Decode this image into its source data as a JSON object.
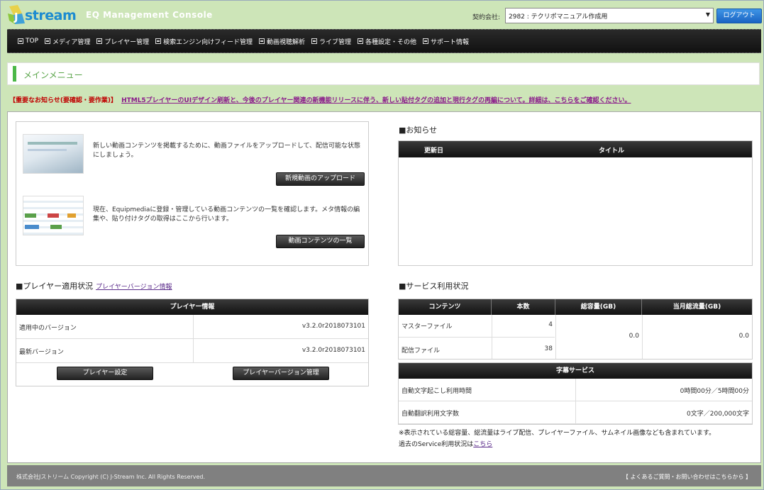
{
  "header": {
    "logo_text": "stream",
    "app_title": "EQ Management Console",
    "contract_label": "契約会社:",
    "contract_value": "2982 : テクリポマニュアル作成用",
    "logout_label": "ログアウト"
  },
  "nav": {
    "items": [
      "TOP",
      "メディア管理",
      "プレイヤー管理",
      "検索エンジン向けフィード管理",
      "動画視聴解析",
      "ライブ管理",
      "各種設定・その他",
      "サポート情報"
    ]
  },
  "page": {
    "title": "メインメニュー"
  },
  "notice": {
    "prefix": "【重要なお知らせ(要確認・要作業)】",
    "link_text": "HTML5プレイヤーのUIデザイン刷新と、今後のプレイヤー関連の新機能リリースに伴う、新しい貼付タグの追加と現行タグの再編について。詳細は、こちらをご確認ください。"
  },
  "promo": {
    "upload_text": "新しい動画コンテンツを掲載するために、動画ファイルをアップロードして、配信可能な状態にしましょう。",
    "upload_button": "新規動画のアップロード",
    "list_text": "現在、Equipmediaに登録・管理している動画コンテンツの一覧を確認します。メタ情報の編集や、貼り付けタグの取得はここから行います。",
    "list_button": "動画コンテンツの一覧"
  },
  "news": {
    "title": "■お知らせ",
    "col_date": "更新日",
    "col_title": "タイトル"
  },
  "player": {
    "section_title": "■プレイヤー適用状況",
    "section_link": "プレイヤーバージョン情報",
    "table_title": "プレイヤー情報",
    "rows": [
      {
        "label": "適用中のバージョン",
        "value": "v3.2.0r2018073101"
      },
      {
        "label": "最新バージョン",
        "value": "v3.2.0r2018073101"
      }
    ],
    "settings_button": "プレイヤー設定",
    "version_button": "プレイヤーバージョン管理"
  },
  "service": {
    "section_title": "■サービス利用状況",
    "headers": [
      "コンテンツ",
      "本数",
      "総容量(GB)",
      "当月総流量(GB)"
    ],
    "rows": [
      {
        "label": "マスターファイル",
        "count": "4"
      },
      {
        "label": "配信ファイル",
        "count": "38"
      }
    ],
    "total_capacity": "0.0",
    "monthly_traffic": "0.0"
  },
  "subtitle": {
    "title": "字幕サービス",
    "rows": [
      {
        "label": "自動文字起こし利用時間",
        "value": "0時間00分／5時間00分"
      },
      {
        "label": "自動翻訳利用文字数",
        "value": "0文字／200,000文字"
      }
    ]
  },
  "notes": {
    "line1": "※表示されている総容量、総流量はライブ配信、プレイヤーファイル、サムネイル画像なども含まれています。",
    "line2_prefix": "過去のService利用状況は",
    "line2_link": "こちら"
  },
  "footer": {
    "copyright": "株式会社Jストリーム Copyright (C) J-Stream Inc. All Rights Reserved.",
    "contact_link": "【 よくあるご質問・お問い合わせはこちらから 】"
  },
  "colors": {
    "background": "#cde5b8",
    "accent_green": "#4cb848",
    "logout_blue": "#1b64c3",
    "notice_red": "#c00000",
    "link_purple": "#8a1a8a"
  }
}
